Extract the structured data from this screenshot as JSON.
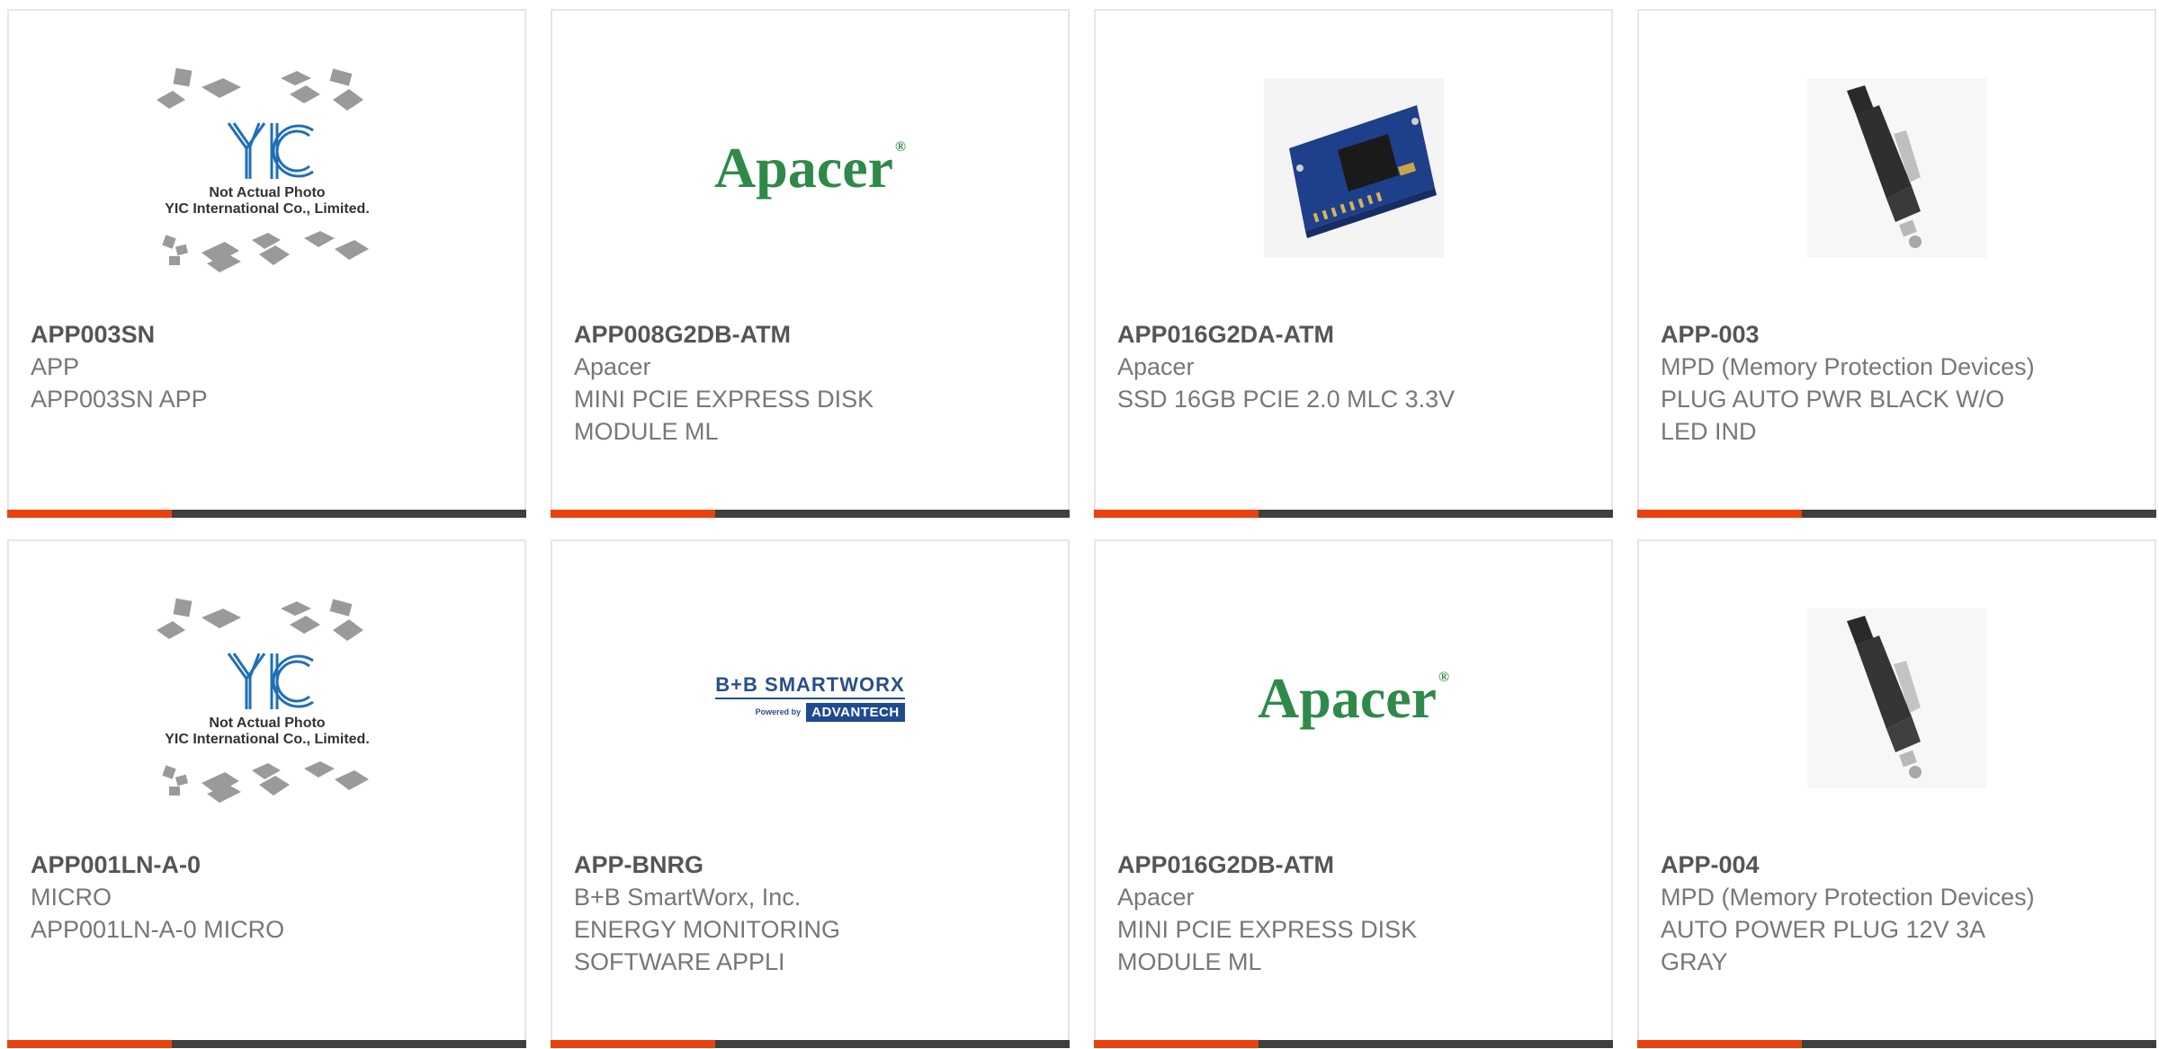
{
  "products": [
    {
      "part_number": "APP003SN",
      "manufacturer": "APP",
      "description": "APP003SN APP",
      "image": "yic-placeholder",
      "image_caption_line1": "Not Actual Photo",
      "image_caption_line2": "YIC International Co., Limited."
    },
    {
      "part_number": "APP008G2DB-ATM",
      "manufacturer": "Apacer",
      "description": "MINI PCIE EXPRESS DISK MODULE ML",
      "image": "apacer-logo",
      "logo_text": "Apacer"
    },
    {
      "part_number": "APP016G2DA-ATM",
      "manufacturer": "Apacer",
      "description": "SSD 16GB PCIE 2.0 MLC 3.3V",
      "image": "ssd-module-photo"
    },
    {
      "part_number": "APP-003",
      "manufacturer": "MPD (Memory Protection Devices)",
      "description": "PLUG AUTO PWR BLACK W/O LED IND",
      "image": "auto-power-plug-photo"
    },
    {
      "part_number": "APP001LN-A-0",
      "manufacturer": "MICRO",
      "description": "APP001LN-A-0 MICRO",
      "image": "yic-placeholder",
      "image_caption_line1": "Not Actual Photo",
      "image_caption_line2": "YIC International Co., Limited."
    },
    {
      "part_number": "APP-BNRG",
      "manufacturer": "B+B SmartWorx, Inc.",
      "description": "ENERGY MONITORING SOFTWARE APPLI",
      "image": "bb-smartworx-logo",
      "logo_top": "B+B SMARTWORX",
      "logo_powered": "Powered by",
      "logo_brand": "ADVANTECH"
    },
    {
      "part_number": "APP016G2DB-ATM",
      "manufacturer": "Apacer",
      "description": "MINI PCIE EXPRESS DISK MODULE ML",
      "image": "apacer-logo",
      "logo_text": "Apacer"
    },
    {
      "part_number": "APP-004",
      "manufacturer": "MPD (Memory Protection Devices)",
      "description": "AUTO POWER PLUG 12V 3A GRAY",
      "image": "auto-power-plug-photo"
    }
  ],
  "colors": {
    "accent": "#e8420f",
    "bar": "#3f3f3f",
    "apacer_green": "#2f8a4a",
    "yic_blue": "#1f6fb8"
  }
}
